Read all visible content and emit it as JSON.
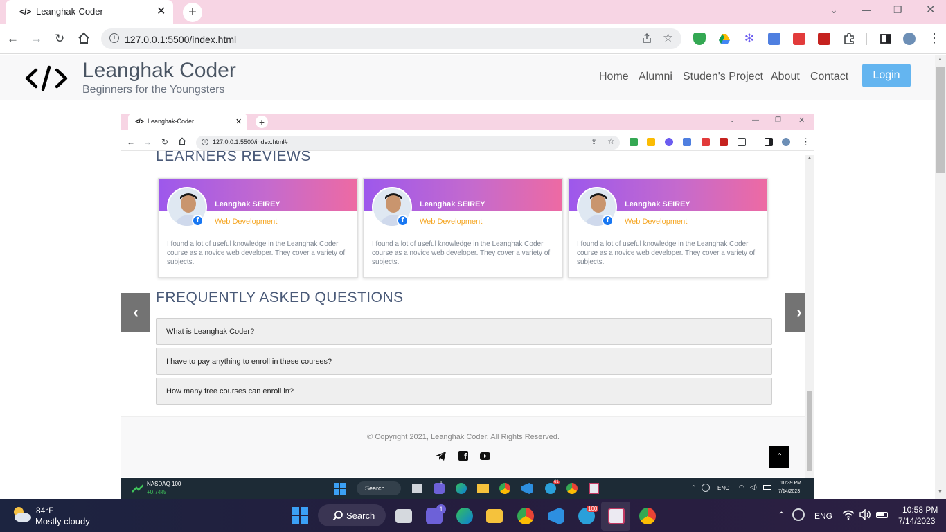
{
  "browser": {
    "tab_title": "Leanghak-Coder",
    "tab_favicon": "</>",
    "new_tab": "+",
    "url": "127.0.0.1:5500/index.html",
    "win_min": "—",
    "win_max": "❐",
    "win_close": "✕",
    "tab_list": "⌄"
  },
  "site": {
    "logo": "</>",
    "brand": "Leanghak Coder",
    "tagline": "Beginners for the Youngsters",
    "nav": [
      "Home",
      "Alumni",
      "Studen's Project",
      "About",
      "Contact"
    ],
    "login": "Login"
  },
  "inner": {
    "tab_title": "Leanghak-Coder",
    "tab_favicon": "</>",
    "url": "127.0.0.1:5500/index.html#",
    "reviews_title": "LEARNERS REVIEWS",
    "reviews": [
      {
        "name": "Leanghak SEIREY",
        "role": "Web Development",
        "text": "I found a lot of useful knowledge in the Leanghak Coder course as a novice web developer. They cover a variety of subjects."
      },
      {
        "name": "Leanghak SEIREY",
        "role": "Web Development",
        "text": "I found a lot of useful knowledge in the Leanghak Coder course as a novice web developer. They cover a variety of subjects."
      },
      {
        "name": "Leanghak SEIREY",
        "role": "Web Development",
        "text": "I found a lot of useful knowledge in the Leanghak Coder course as a novice web developer. They cover a variety of subjects."
      }
    ],
    "fb_glyph": "f",
    "faq_title": "FREQUENTLY ASKED QUESTIONS",
    "faqs": [
      "What is Leanghak Coder?",
      "I have to pay anything to enroll in these courses?",
      "How many free courses can enroll in?"
    ],
    "prev": "‹",
    "next": "›",
    "copyright": "© Copyright 2021, Leanghak Coder. All Rights Reserved.",
    "to_top": "⌃",
    "taskbar": {
      "stock_name": "NASDAQ 100",
      "stock_change": "+0.74%",
      "search": "Search",
      "lang": "ENG",
      "time": "10:39 PM",
      "date": "7/14/2023",
      "badge_teams": "1",
      "badge_tg": "61"
    }
  },
  "taskbar": {
    "temp": "84°F",
    "weather": "Mostly cloudy",
    "search": "Search",
    "lang": "ENG",
    "time": "10:58 PM",
    "date": "7/14/2023",
    "badge_teams": "1",
    "badge_tg": "100"
  },
  "colors": {
    "accent_login": "#64b5f0",
    "card_gradient_start": "#9d58ec",
    "card_gradient_end": "#ee6aa2",
    "tabbar": "#f7d5e4"
  }
}
